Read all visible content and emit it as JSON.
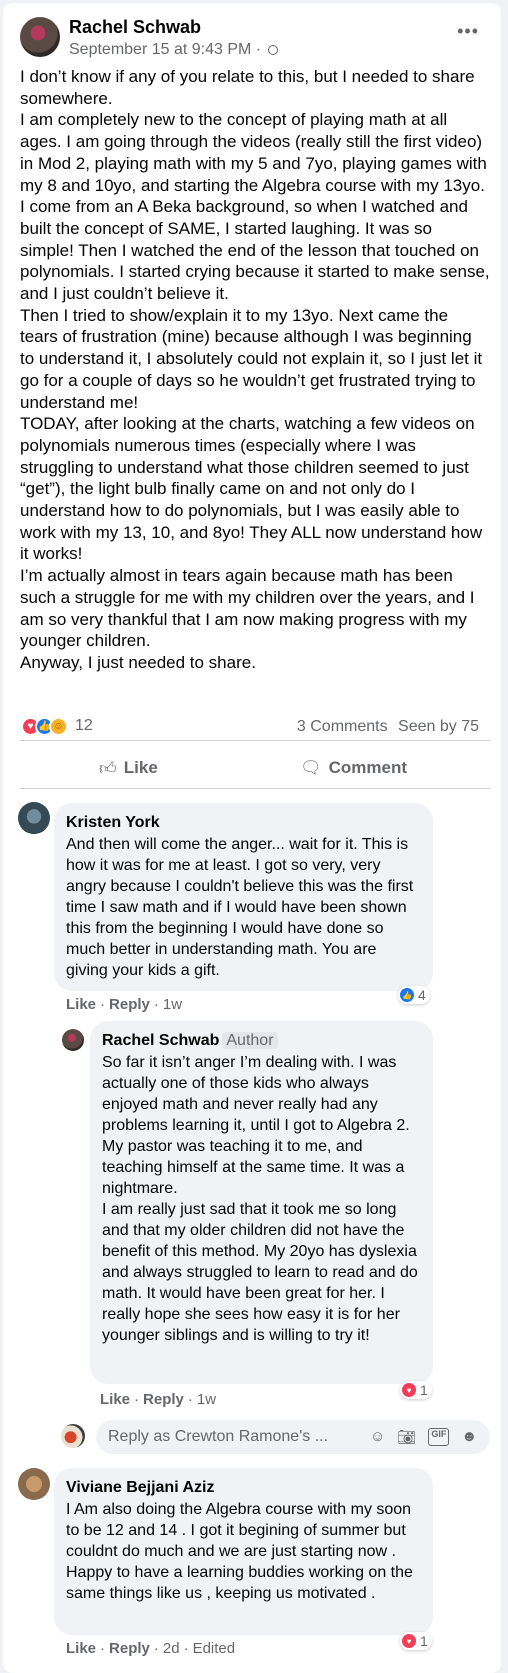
{
  "post": {
    "author": "Rachel Schwab",
    "timestamp": "September 15 at 9:43 PM",
    "visibility_icon": "globe-icon",
    "more_icon": "•••",
    "paragraphs": [
      "I don’t know if any of you relate to this, but I needed to share somewhere.",
      "I am completely new to the concept of playing math at all ages. I am going through the videos (really still the first video) in Mod 2, playing math with my 5 and 7yo, playing games with my 8 and 10yo, and starting the Algebra course with my 13yo.",
      "I come from an A Beka background, so when I watched and built the concept of SAME, I started laughing. It was so simple! Then I watched the end of the lesson that touched on polynomials. I started crying because it started to make sense, and I just couldn’t believe it.",
      "Then I tried to show/explain it to my 13yo. Next came the tears of frustration (mine) because although I was beginning to understand it, I absolutely could not explain it, so I just let it go for a couple of days so he wouldn’t get frustrated trying to understand me!",
      "TODAY, after looking at the charts, watching a few videos on polynomials numerous times (especially where I was struggling to understand what those children seemed to just “get”), the light bulb finally came on and not only do I understand how to do polynomials, but I was easily able to work with my 13, 10, and 8yo! They ALL now understand how it works!",
      "I’m actually almost in tears again because math has been such a struggle for me with my children over the years, and I am so very thankful that I am now making progress with my younger children.",
      "Anyway, I just needed to share."
    ],
    "reaction_count": "12",
    "comments_count": "3 Comments",
    "seen_by": "Seen by 75",
    "like_label": "Like",
    "comment_label": "Comment"
  },
  "comments": [
    {
      "author": "Kristen York",
      "text": "And then will come the anger... wait for it. This is how it was for me at least. I got so very, very angry because I couldn't believe this was the first time I saw math and if I would have been shown this from the beginning I would have done so much better in understanding math. You are giving your kids a gift.",
      "like": "Like",
      "reply": "Reply",
      "time": "1w",
      "reaction_count": "4",
      "reaction_type": "like"
    },
    {
      "author": "Rachel Schwab",
      "badge": "Author",
      "text_1": "So far it isn’t anger I’m dealing with. I was actually one of those kids who always enjoyed math and never really had any problems learning it, until I got to Algebra 2. My pastor was teaching it to me, and teaching himself at the same time. It was a nightmare.",
      "text_2": "I am really just sad that it took me so long and that my older children did not have the benefit of this method. My 20yo has dyslexia and always struggled to learn to read and do math. It would have been great for her. I really hope she sees how easy it is for her younger siblings and is willing to try it!",
      "like": "Like",
      "reply": "Reply",
      "time": "1w",
      "reaction_count": "1",
      "reaction_type": "love"
    },
    {
      "author": "Viviane Bejjani Aziz",
      "text": "I Am also doing the Algebra course with my soon to be 12 and 14 . I got it begining of summer but couldnt do much and we are just starting now . Happy to have a learning buddies working on the same things like us , keeping us motivated .",
      "like": "Like",
      "reply": "Reply",
      "time": "2d",
      "edited": "Edited",
      "reaction_count": "1",
      "reaction_type": "love"
    }
  ],
  "reply_box": {
    "placeholder": "Reply as Crewton Ramone's ...",
    "icons": [
      "emoji-icon",
      "camera-icon",
      "gif-icon",
      "sticker-icon"
    ]
  },
  "colors": {
    "like_blue": "#1877f2",
    "love_red": "#f33e58",
    "secondary_text": "#65676b"
  }
}
